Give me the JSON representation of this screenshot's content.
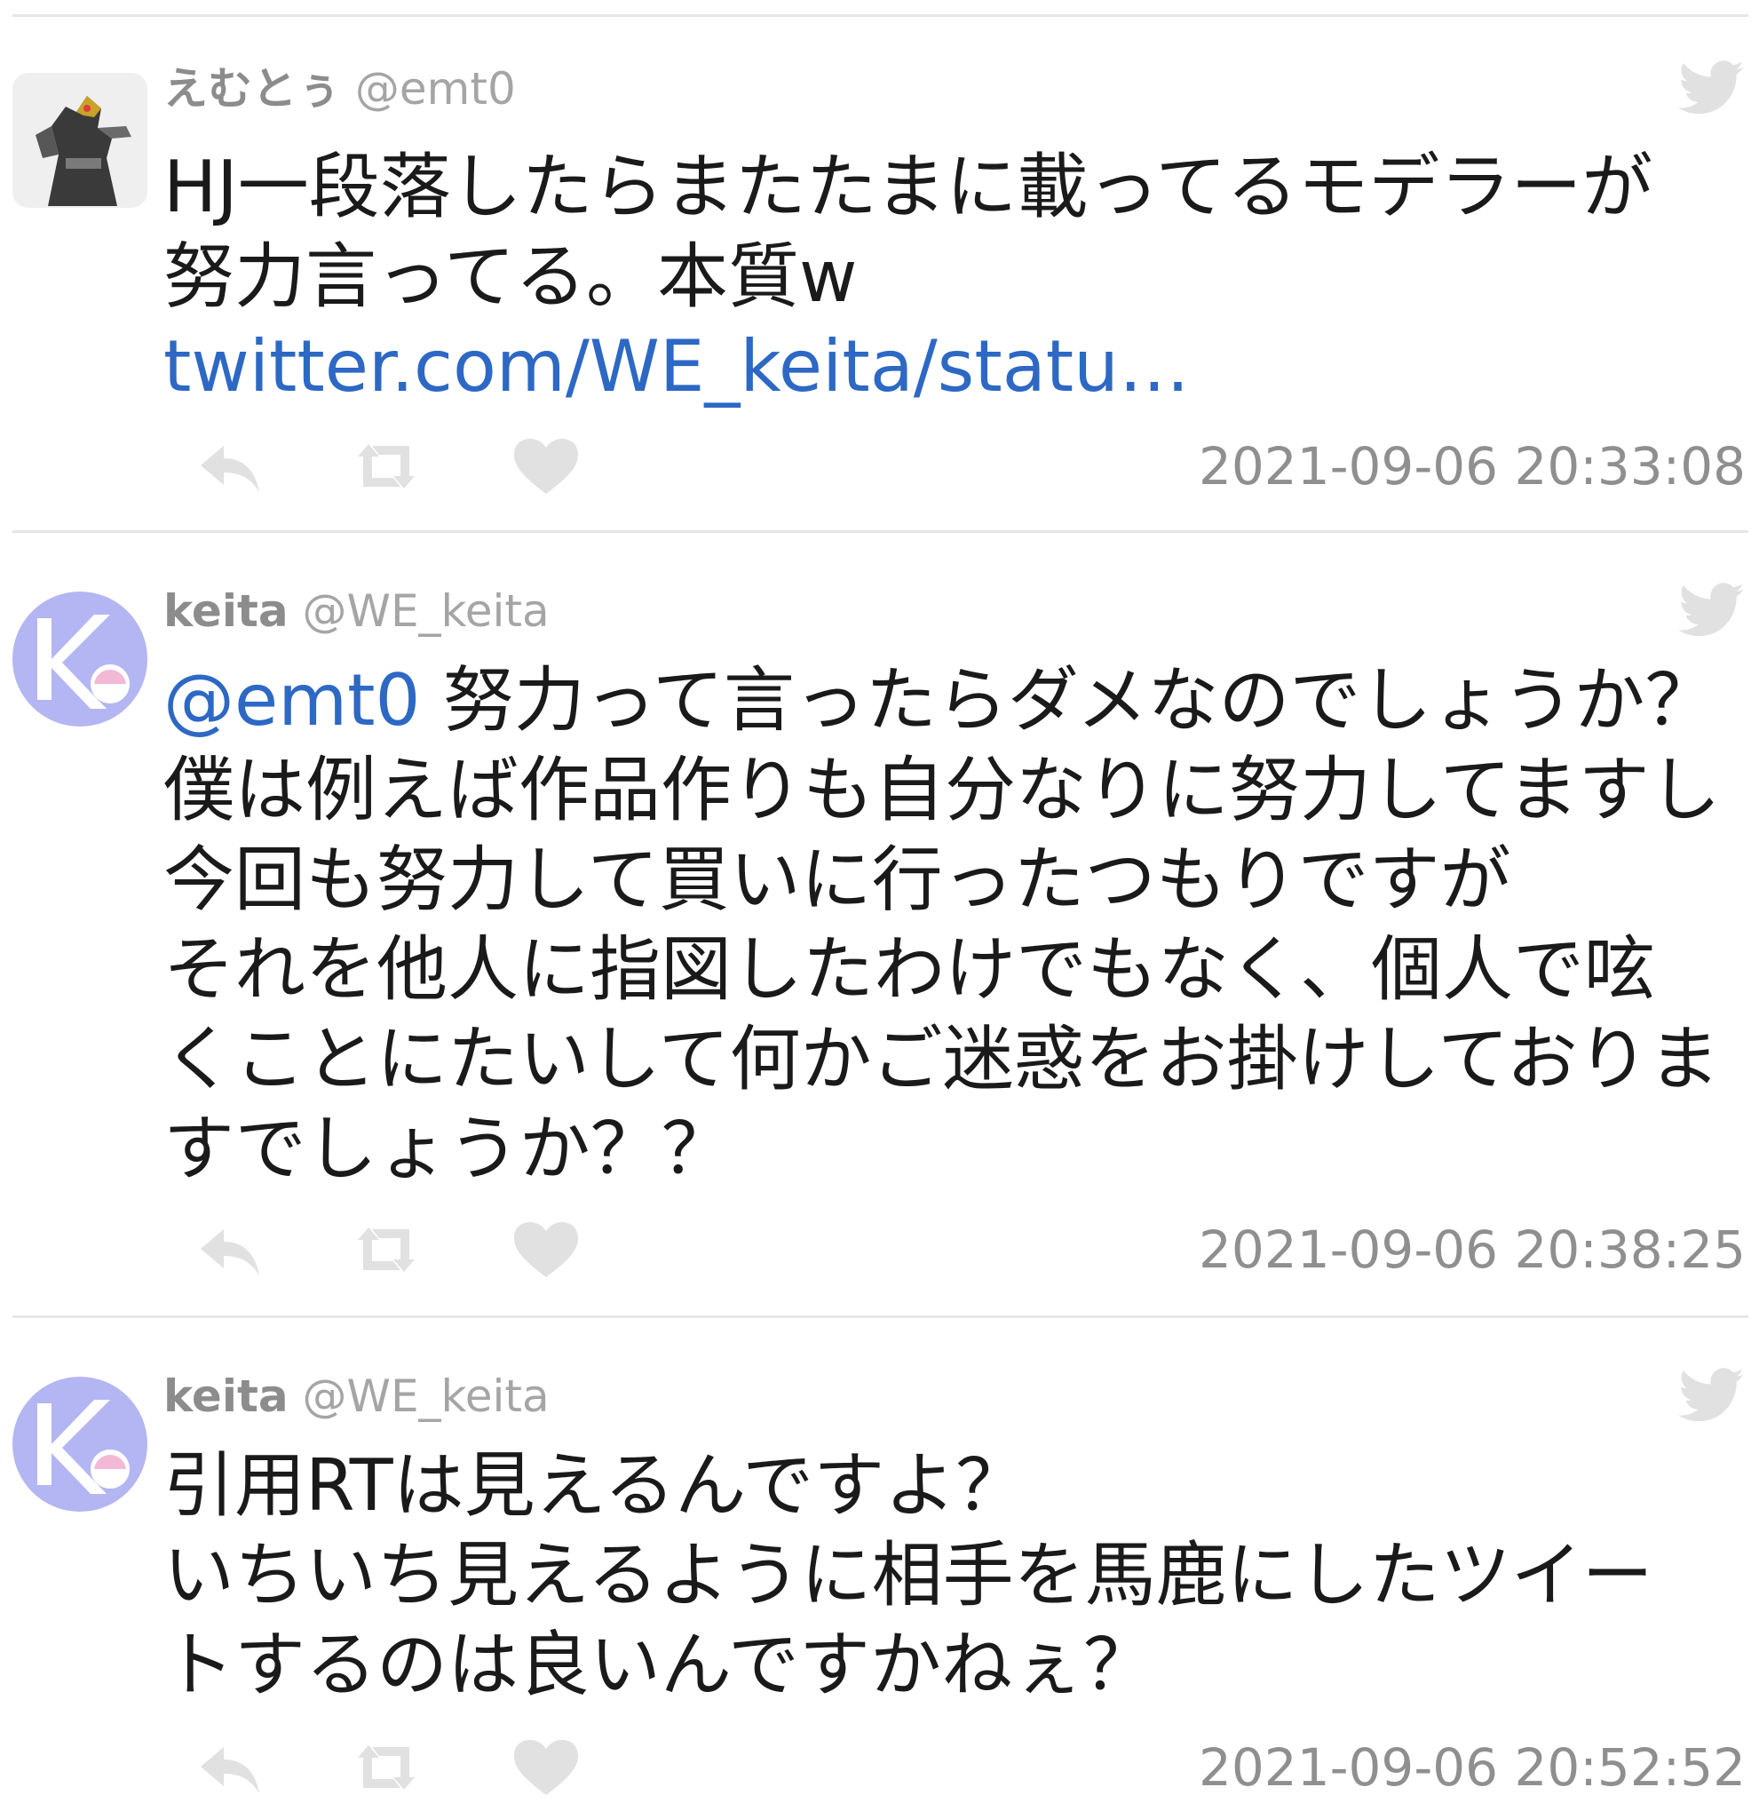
{
  "tweets": [
    {
      "display_name": "えむとぅ",
      "handle": "@emt0",
      "lines": [
        "HJ一段落したらまたたまに載ってるモデラーが",
        "努力言ってる。本質w"
      ],
      "link": "twitter.com/WE_keita/statu…",
      "timestamp": "2021-09-06 20:33:08"
    },
    {
      "display_name": "keita",
      "handle": "@WE_keita",
      "mention": "@emt0",
      "first_line_rest": " 努力って言ったらダメなのでしょうか？",
      "lines": [
        "僕は例えば作品作りも自分なりに努力してますし",
        "今回も努力して買いに行ったつもりですが",
        "それを他人に指図したわけでもなく、個人で呟",
        "くことにたいして何かご迷惑をお掛けしておりま",
        "すでしょうか？？"
      ],
      "timestamp": "2021-09-06 20:38:25"
    },
    {
      "display_name": "keita",
      "handle": "@WE_keita",
      "lines": [
        "引用RTは見えるんですよ？",
        "いちいち見えるように相手を馬鹿にしたツイー",
        "トするのは良いんですかねぇ？"
      ],
      "timestamp": "2021-09-06 20:52:52"
    }
  ],
  "icons": {
    "reply": "reply-icon",
    "retweet": "retweet-icon",
    "like": "heart-icon",
    "source": "twitter-bird-icon"
  },
  "colors": {
    "link": "#2d68c4",
    "meta": "#9a9a9a",
    "icon": "#e1e1e1",
    "divider": "#e6e6e6",
    "avatar_keita": "#b3b6f2"
  }
}
